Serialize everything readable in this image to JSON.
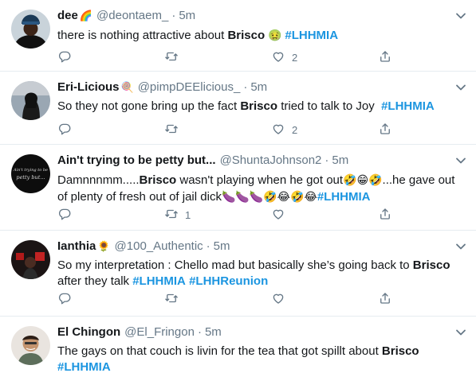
{
  "tweets": [
    {
      "name": "dee",
      "name_emoji": "🌈",
      "handle": "@deontaem_",
      "sep": "·",
      "time": "5m",
      "text": [
        {
          "t": "there is nothing attractive about ",
          "s": "n"
        },
        {
          "t": "Brisco",
          "s": "b"
        },
        {
          "t": " 🤢 ",
          "s": "e"
        },
        {
          "t": "#LHHMIA",
          "s": "h"
        }
      ],
      "reply_count": "",
      "retweet_count": "",
      "like_count": "2"
    },
    {
      "name": "Eri-Licious",
      "name_emoji": "🍭",
      "handle": "@pimpDEElicious_",
      "sep": "·",
      "time": "5m",
      "text": [
        {
          "t": "So they not gone bring up the fact ",
          "s": "n"
        },
        {
          "t": "Brisco",
          "s": "b"
        },
        {
          "t": " tried to talk to Joy  ",
          "s": "n"
        },
        {
          "t": "#LHHMIA",
          "s": "h"
        }
      ],
      "reply_count": "",
      "retweet_count": "",
      "like_count": "2"
    },
    {
      "name": "Ain't trying to be petty but...",
      "name_emoji": "",
      "handle": "@ShuntaJohnson2",
      "sep": "·",
      "time": "5m",
      "avatar_text": "Ain't trying to be petty but...",
      "text": [
        {
          "t": "Damnnnmm.....",
          "s": "n"
        },
        {
          "t": "Brisco",
          "s": "b"
        },
        {
          "t": " wasn't playing when he got out",
          "s": "n"
        },
        {
          "t": "🤣😁🤣",
          "s": "e"
        },
        {
          "t": "...he gave out of plenty of fresh out of jail dick",
          "s": "n"
        },
        {
          "t": "🍆🍆🍆🤣😂🤣😂",
          "s": "e"
        },
        {
          "t": "#LHHMIA",
          "s": "h"
        }
      ],
      "reply_count": "",
      "retweet_count": "1",
      "like_count": ""
    },
    {
      "name": "Ianthia",
      "name_emoji": "🌻",
      "handle": "@100_Authentic",
      "sep": "·",
      "time": "5m",
      "text": [
        {
          "t": "So my interpretation : Chello mad but basically she’s going back to ",
          "s": "n"
        },
        {
          "t": "Brisco",
          "s": "b"
        },
        {
          "t": " after they talk ",
          "s": "n"
        },
        {
          "t": "#LHHMIA",
          "s": "h"
        },
        {
          "t": " ",
          "s": "n"
        },
        {
          "t": "#LHHReunion",
          "s": "h"
        }
      ],
      "reply_count": "",
      "retweet_count": "",
      "like_count": ""
    },
    {
      "name": "El Chingon",
      "name_emoji": "",
      "handle": "@El_Fringon",
      "sep": "·",
      "time": "5m",
      "text": [
        {
          "t": "The gays on that couch is livin for the tea that got spillt about ",
          "s": "n"
        },
        {
          "t": "Brisco",
          "s": "b"
        },
        {
          "t": " ",
          "s": "n"
        },
        {
          "t": "#LHHMIA",
          "s": "h"
        }
      ],
      "reply_count": "",
      "retweet_count": "",
      "like_count": ""
    }
  ],
  "colors": {
    "text": "#14171a",
    "secondary": "#657786",
    "hashtag": "#1b95e0",
    "divider": "#e6ecf0"
  },
  "icons": {
    "reply": "reply-icon",
    "retweet": "retweet-icon",
    "like": "heart-icon",
    "share": "share-icon",
    "menu": "chevron-down-icon"
  }
}
